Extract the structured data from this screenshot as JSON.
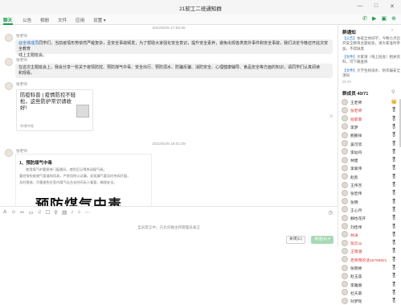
{
  "window": {
    "title": "21软工二班通知群",
    "controls": [
      "—",
      "□",
      "✕"
    ]
  },
  "tabs": [
    {
      "label": "聊天",
      "active": true
    },
    {
      "label": "公告",
      "active": false
    },
    {
      "label": "相册",
      "active": false
    },
    {
      "label": "文件",
      "active": false
    },
    {
      "label": "应用",
      "active": false
    },
    {
      "label": "设置 ▾",
      "active": false
    }
  ],
  "tab_icons": [
    "phone-icon",
    "video-icon",
    "share-screen-icon",
    "more-icon"
  ],
  "chat": {
    "timestamp1": "2022/5/29 17:58:36",
    "sender1": "张老师",
    "msg1_at": "@全体成员",
    "msg1_lines": [
      "同学们，当前疫情形势依然严峻复杂，且安全事故频发，为了帮助大家强化安全意识，提升安全素养，避免出现各类意外事件和安全事故，我们决定今晚召开此次安全教育",
      "线上主题班会。"
    ],
    "sender2": "张老师",
    "msg2_lines": [
      "在这次主题班会上，我会分享一些关于疫情防控、预防煤气中毒、安全出行、预防溺水、防骗反骗、消防安全、心理健康辅导、食品安全等方面的知识，请同学们认真阅读",
      "和观看。"
    ],
    "sender3": "张老师",
    "link_title": "防疫科普 | 疫情防控不轻松，这些防护常识请收好!",
    "link_source": "哔哩哔哩",
    "timestamp2": "2022/5/29 18:01:09",
    "sender4": "张老师",
    "doc_heading": "1、预防煤气中毒",
    "doc_lines": [
      "使用煤气炉要保持门窗通风，使用后记得关闭煤气阀。",
      "要经常检查燃气管道和用具，严禁用明火试漏，发现漏气要及时关阀开窗，",
      "及时报修，尽量避免在室内煤气灶台长时间无人看管，确保安全。"
    ],
    "doc_big": "预防煤气中毒"
  },
  "composer": {
    "tools": [
      "A",
      "☺",
      "✂",
      "▭",
      "♫",
      "☐",
      "⚲",
      "▤",
      "♪",
      "⌂",
      "⋯"
    ],
    "history_icon": "◷",
    "banned_text": "全员禁言中，只允许群主和管理员发言",
    "close_label": "关闭(C)",
    "send_label": "发送(S) ▾"
  },
  "side": {
    "notice_title": "群通知",
    "notices": [
      {
        "tag": "【公告】",
        "text": "本班全体同学，今晚七点召开安全教育主题班会，请大家准时参加，不得缺席"
      },
      {
        "tag": "【文件】",
        "text": "大家请（线上班会）相关资料，可下载查阅"
      },
      {
        "tag": "【文件】",
        "text": "大学生防溺水、防诈骗安全须知"
      }
    ],
    "notice_date": "05-29",
    "members_title": "群成员 40/71",
    "members": [
      {
        "name": "王老师",
        "red": false,
        "badge": "👑"
      },
      {
        "name": "张老师",
        "red": true,
        "badge": "🎖"
      },
      {
        "name": "钱菲菲",
        "red": true,
        "badge": "🎖"
      },
      {
        "name": "李梦",
        "red": false,
        "badge": "🎖"
      },
      {
        "name": "鲍鹏祥",
        "red": false,
        "badge": "🎖"
      },
      {
        "name": "吴可欣",
        "red": false,
        "badge": "🎖"
      },
      {
        "name": "李幼丹",
        "red": false,
        "badge": "🎖"
      },
      {
        "name": "林建",
        "red": false,
        "badge": "🎖"
      },
      {
        "name": "李家伟",
        "red": false,
        "badge": "🎖"
      },
      {
        "name": "赵凯",
        "red": false,
        "badge": "🎖"
      },
      {
        "name": "王伟杰",
        "red": false,
        "badge": "🎖"
      },
      {
        "name": "张宏伟",
        "red": false,
        "badge": "🎖"
      },
      {
        "name": "张明",
        "red": false,
        "badge": "🎖"
      },
      {
        "name": "王心月",
        "red": false,
        "badge": "🎖"
      },
      {
        "name": "静怡花开",
        "red": false,
        "badge": "🎖"
      },
      {
        "name": "刘佳伟",
        "red": false,
        "badge": "🎖"
      },
      {
        "name": "林涛",
        "red": true,
        "badge": "🎖"
      },
      {
        "name": "张云山",
        "red": true,
        "badge": "🎖"
      },
      {
        "name": "王雨涵",
        "red": true,
        "badge": "🎖"
      },
      {
        "name": "老师用的话18759921",
        "red": true,
        "badge": "🎖"
      },
      {
        "name": "张晓婷",
        "red": false,
        "badge": "🎖"
      },
      {
        "name": "赵玉莲",
        "red": false,
        "badge": "🎖"
      },
      {
        "name": "李雅丽",
        "red": false,
        "badge": "🎖"
      },
      {
        "name": "杜天豪",
        "red": false,
        "badge": "🎖"
      },
      {
        "name": "孙梦瑶",
        "red": false,
        "badge": "🎖"
      }
    ]
  },
  "colors": {
    "accent": "#1a9a4a",
    "at_blue": "#1a6cc9",
    "red_name": "#e03a3a",
    "send_button": "#a8d9b6"
  }
}
